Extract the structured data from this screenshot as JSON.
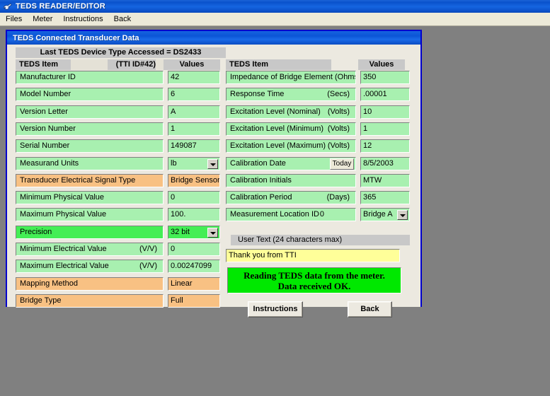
{
  "app": {
    "title": "TEDS READER/EDITOR",
    "icon": "app-icon",
    "menu": [
      "Files",
      "Meter",
      "Instructions",
      "Back"
    ]
  },
  "child_window": {
    "title": "TEDS Connected Transducer Data",
    "device_banner": "Last TEDS Device Type Accessed = DS2433"
  },
  "left_table": {
    "header_item": "TEDS Item",
    "header_id": "(TTI ID#42)",
    "header_values": "Values",
    "rows": [
      {
        "label": "Manufacturer ID",
        "value": "42",
        "style": "green",
        "control": "text"
      },
      {
        "label": "Model Number",
        "value": "6",
        "style": "green",
        "control": "text"
      },
      {
        "label": "Version Letter",
        "value": "A",
        "style": "green",
        "control": "text"
      },
      {
        "label": "Version Number",
        "value": "1",
        "style": "green",
        "control": "text"
      },
      {
        "label": "Serial Number",
        "value": "149087",
        "style": "green",
        "control": "text"
      },
      {
        "label": "Measurand Units",
        "value": "lb",
        "style": "green",
        "control": "dropdown"
      },
      {
        "label": "Transducer Electrical Signal Type",
        "value": "Bridge Sensor",
        "style": "orange",
        "control": "text"
      },
      {
        "label": "Minimum Physical Value",
        "value": "0",
        "style": "green",
        "control": "text"
      },
      {
        "label": "Maximum Physical Value",
        "value": "100.",
        "style": "green",
        "control": "text"
      },
      {
        "label": "Precision",
        "value": "32 bit",
        "style": "green-bright",
        "control": "dropdown"
      },
      {
        "label": "Minimum Electrical Value",
        "suffix": "(V/V)",
        "value": "0",
        "style": "green",
        "control": "text"
      },
      {
        "label": "Maximum Electrical Value",
        "suffix": "(V/V)",
        "value": "0.00247099",
        "style": "green",
        "control": "text"
      },
      {
        "label": "Mapping Method",
        "value": "Linear",
        "style": "orange",
        "control": "text"
      },
      {
        "label": "Bridge Type",
        "value": "Full",
        "style": "orange",
        "control": "text"
      }
    ]
  },
  "right_table": {
    "header_item": "TEDS Item",
    "header_values": "Values",
    "rows": [
      {
        "label": "Impedance of Bridge Element (Ohms)",
        "value": "350",
        "style": "green",
        "control": "text"
      },
      {
        "label": "Response Time",
        "suffix": "(Secs)",
        "value": ".00001",
        "style": "green",
        "control": "text"
      },
      {
        "label": "Excitation Level (Nominal)",
        "suffix": "(Volts)",
        "value": "10",
        "style": "green",
        "control": "text"
      },
      {
        "label": "Excitation Level (Minimum)",
        "suffix": "(Volts)",
        "value": "1",
        "style": "green",
        "control": "text"
      },
      {
        "label": "Excitation Level (Maximum)",
        "suffix": "(Volts)",
        "value": "12",
        "style": "green",
        "control": "text"
      },
      {
        "label": "Calibration Date",
        "button": "Today",
        "value": "8/5/2003",
        "style": "green",
        "control": "text"
      },
      {
        "label": "Calibration Initials",
        "value": "MTW",
        "style": "green",
        "control": "text"
      },
      {
        "label": "Calibration Period",
        "suffix": "(Days)",
        "value": "365",
        "style": "green",
        "control": "text"
      },
      {
        "label": "Measurement Location ID",
        "locid": "0",
        "value": "Bridge A",
        "style": "green",
        "control": "dropdown"
      }
    ]
  },
  "user_text": {
    "header": "User Text (24 characters max)",
    "value": "Thank you from TTI"
  },
  "status": {
    "line1": "Reading TEDS data from the meter.",
    "line2": "Data received OK.",
    "color": "#00e800"
  },
  "buttons": {
    "instructions": "Instructions",
    "back": "Back"
  },
  "colors": {
    "title_blue": "#0a52cc",
    "window_face": "#ece9e0",
    "green_field": "#a8f0b0",
    "green_highlight": "#44ee55",
    "orange_field": "#f8c183",
    "yellow_field": "#ffff99",
    "header_grey": "#c8c8c8",
    "desktop": "#808080"
  }
}
